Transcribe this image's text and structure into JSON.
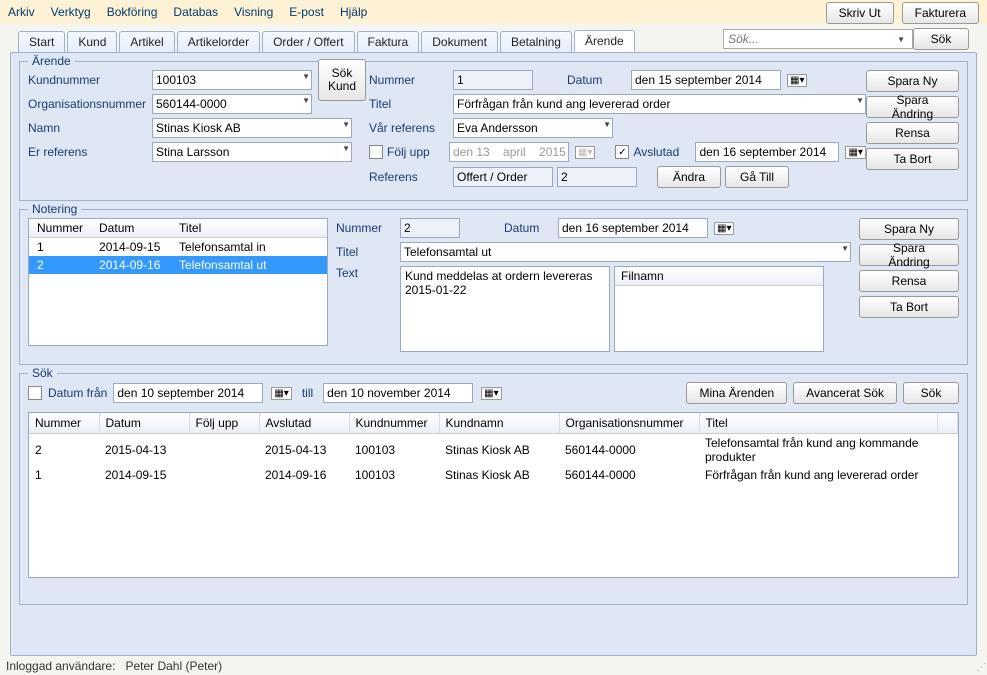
{
  "menubar": {
    "items": [
      "Arkiv",
      "Verktyg",
      "Bokföring",
      "Databas",
      "Visning",
      "E-post",
      "Hjälp"
    ]
  },
  "topButtons": {
    "print": "Skriv Ut",
    "invoice": "Fakturera"
  },
  "tabs": [
    "Start",
    "Kund",
    "Artikel",
    "Artikelorder",
    "Order / Offert",
    "Faktura",
    "Dokument",
    "Betalning",
    "Ärende"
  ],
  "activeTab": "Ärende",
  "searchTop": {
    "placeholder": "Sök...",
    "button": "Sök"
  },
  "arende": {
    "legend": "Ärende",
    "left": {
      "kundnummer_label": "Kundnummer",
      "kundnummer": "100103",
      "orgnr_label": "Organisationsnummer",
      "orgnr": "560144-0000",
      "namn_label": "Namn",
      "namn": "Stinas Kiosk AB",
      "erref_label": "Er referens",
      "erref": "Stina Larsson",
      "sok_kund": "Sök\nKund"
    },
    "mid": {
      "nummer_label": "Nummer",
      "nummer": "1",
      "datum_label": "Datum",
      "datum": "den 15 september 2014",
      "titel_label": "Titel",
      "titel": "Förfrågan från kund ang levererad order",
      "varref_label": "Vår referens",
      "varref": "Eva Andersson",
      "foljupp_label": "Följ upp",
      "foljupp_date": "den 13    april    2015",
      "avslutad_label": "Avslutad",
      "avslutad_date": "den 16 september 2014",
      "referens_label": "Referens",
      "referens_type": "Offert / Order",
      "referens_num": "2",
      "andra": "Ändra",
      "gatill": "Gå Till"
    },
    "buttons": {
      "spara_ny": "Spara Ny",
      "spara_andring": "Spara Ändring",
      "rensa": "Rensa",
      "ta_bort": "Ta Bort"
    }
  },
  "notering": {
    "legend": "Notering",
    "columns": [
      "Nummer",
      "Datum",
      "Titel"
    ],
    "rows": [
      {
        "nummer": "1",
        "datum": "2014-09-15",
        "titel": "Telefonsamtal in",
        "selected": false
      },
      {
        "nummer": "2",
        "datum": "2014-09-16",
        "titel": "Telefonsamtal ut",
        "selected": true
      }
    ],
    "detail": {
      "nummer_label": "Nummer",
      "nummer": "2",
      "datum_label": "Datum",
      "datum": "den 16 september 2014",
      "titel_label": "Titel",
      "titel": "Telefonsamtal ut",
      "text_label": "Text",
      "text": "Kund meddelas at ordern levereras 2015-01-22",
      "filnamn_label": "Filnamn"
    },
    "buttons": {
      "spara_ny": "Spara Ny",
      "spara_andring": "Spara Ändring",
      "rensa": "Rensa",
      "ta_bort": "Ta Bort"
    }
  },
  "sok": {
    "legend": "Sök",
    "datum_fran_label": "Datum från",
    "datum_fran": "den 10 september 2014",
    "till_label": "till",
    "datum_till": "den 10 november 2014",
    "mina": "Mina Ärenden",
    "avancerat": "Avancerat Sök",
    "sok": "Sök",
    "columns": [
      "Nummer",
      "Datum",
      "Följ upp",
      "Avslutad",
      "Kundnummer",
      "Kundnamn",
      "Organisationsnummer",
      "Titel"
    ],
    "rows": [
      {
        "nummer": "2",
        "datum": "2015-04-13",
        "foljupp": "",
        "avslutad": "2015-04-13",
        "kundnummer": "100103",
        "kundnamn": "Stinas Kiosk AB",
        "orgnr": "560144-0000",
        "titel": "Telefonsamtal från kund ang kommande produkter"
      },
      {
        "nummer": "1",
        "datum": "2014-09-15",
        "foljupp": "",
        "avslutad": "2014-09-16",
        "kundnummer": "100103",
        "kundnamn": "Stinas Kiosk AB",
        "orgnr": "560144-0000",
        "titel": "Förfrågan från kund ang levererad order"
      }
    ]
  },
  "status": {
    "label": "Inloggad användare:",
    "value": "Peter Dahl (Peter)"
  }
}
